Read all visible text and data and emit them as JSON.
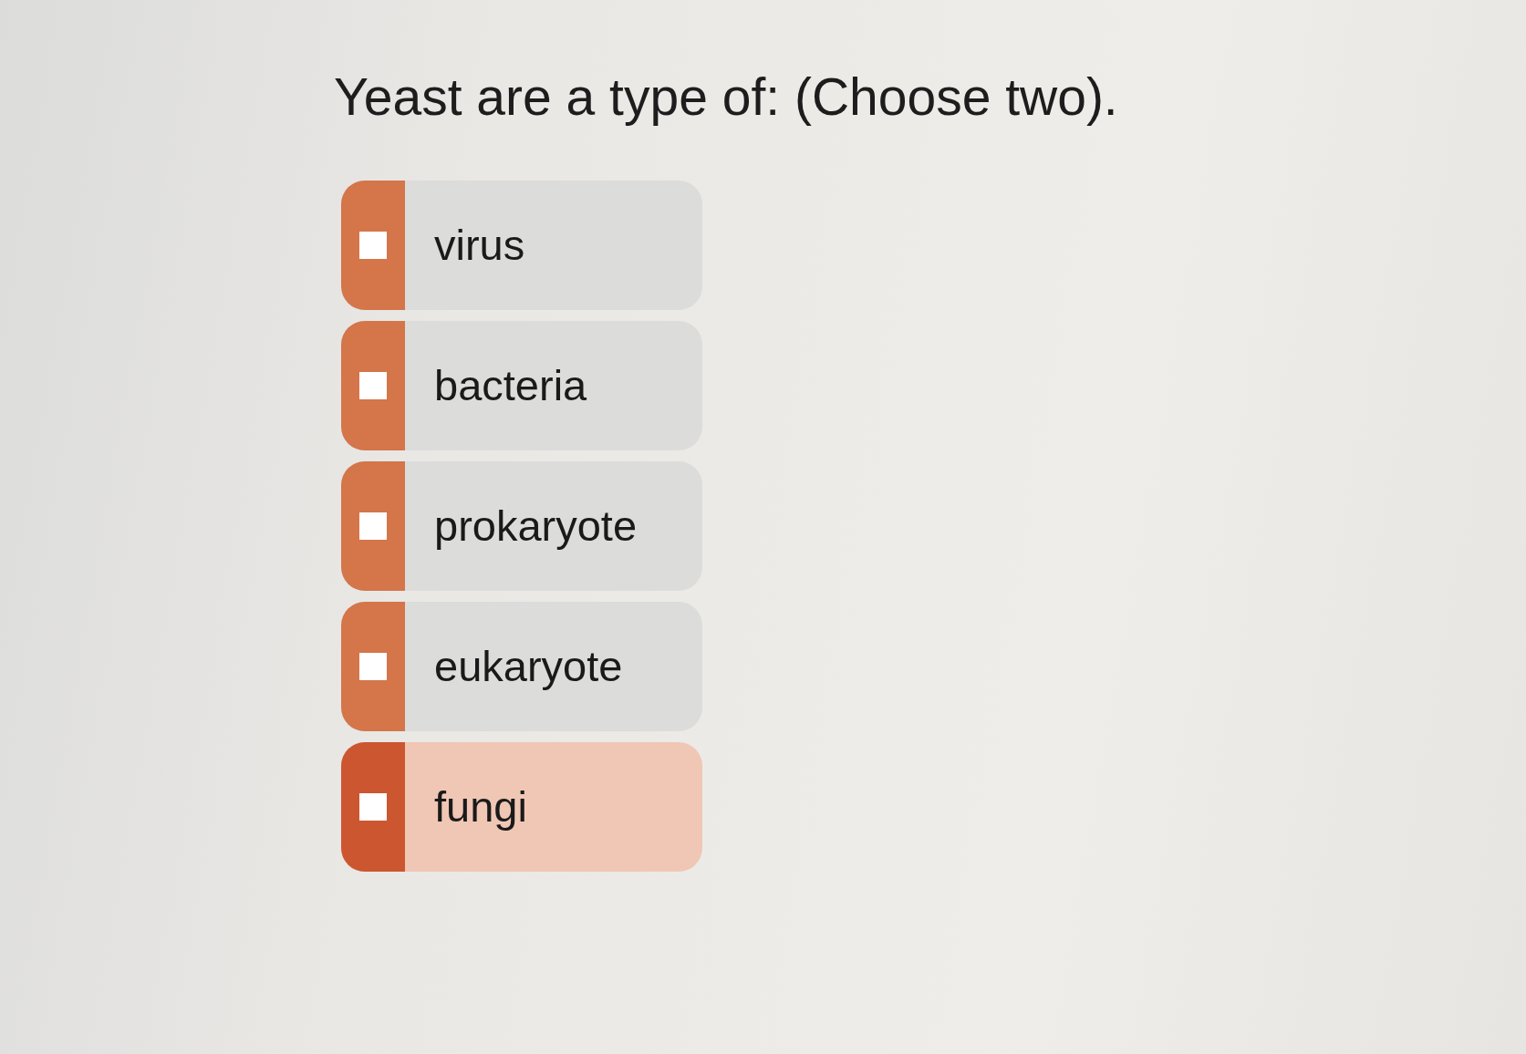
{
  "question": "Yeast are a type of: (Choose two).",
  "options": [
    {
      "label": "virus",
      "checked": false,
      "highlighted": false
    },
    {
      "label": "bacteria",
      "checked": false,
      "highlighted": false
    },
    {
      "label": "prokaryote",
      "checked": false,
      "highlighted": false
    },
    {
      "label": "eukaryote",
      "checked": false,
      "highlighted": false
    },
    {
      "label": "fungi",
      "checked": false,
      "highlighted": true
    }
  ]
}
